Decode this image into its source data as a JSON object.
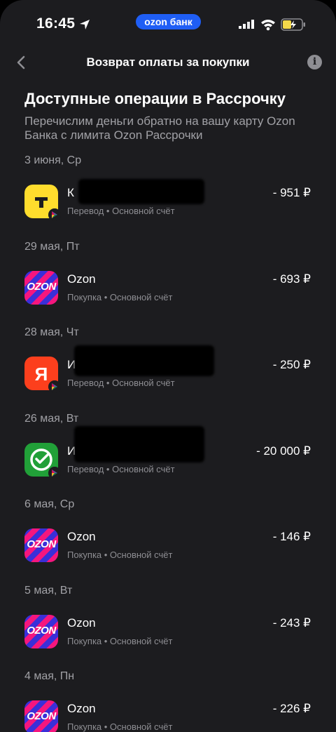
{
  "status_bar": {
    "time": "16:45",
    "pill": "ozon банк"
  },
  "nav": {
    "title": "Возврат оплаты за покупки",
    "info_icon": "info-icon",
    "back_icon": "chevron-left-icon"
  },
  "heading": "Доступные операции в Рассрочку",
  "subheading": "Перечислим деньги обратно на вашу карту Ozon Банка с лимита Ozon Рассрочки",
  "groups": [
    {
      "date": "3 июня, Ср",
      "logo": "tbank-logo",
      "name": "К",
      "meta": "Перевод • Основной счёт",
      "amount": "- 951 ₽"
    },
    {
      "date": "29 мая, Пт",
      "logo": "ozon-logo",
      "name": "Ozon",
      "meta": "Покупка • Основной счёт",
      "amount": "- 693 ₽"
    },
    {
      "date": "28 мая, Чт",
      "logo": "yandex-logo",
      "name": "И",
      "meta": "Перевод • Основной счёт",
      "amount": "- 250 ₽"
    },
    {
      "date": "26 мая, Вт",
      "logo": "sber-logo",
      "name": "И",
      "meta": "Перевод • Основной счёт",
      "amount": "- 20 000 ₽"
    },
    {
      "date": "6 мая, Ср",
      "logo": "ozon-logo",
      "name": "Ozon",
      "meta": "Покупка • Основной счёт",
      "amount": "- 146 ₽"
    },
    {
      "date": "5 мая, Вт",
      "logo": "ozon-logo",
      "name": "Ozon",
      "meta": "Покупка • Основной счёт",
      "amount": "- 243 ₽"
    },
    {
      "date": "4 мая, Пн",
      "logo": "ozon-logo",
      "name": "Ozon",
      "meta": "Покупка • Основной счёт",
      "amount": "- 226 ₽"
    }
  ],
  "colors": {
    "background": "#1c1c1f",
    "accent": "#1f5ef5",
    "secondary_text": "#a1a1a6"
  }
}
